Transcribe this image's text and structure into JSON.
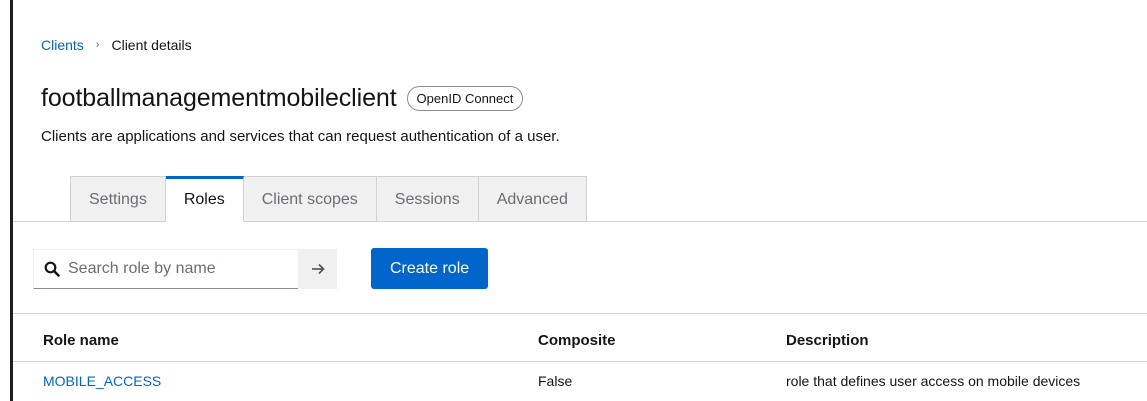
{
  "breadcrumb": {
    "parent": "Clients",
    "separator": "›",
    "current": "Client details"
  },
  "header": {
    "title": "footballmanagementmobileclient",
    "badge": "OpenID Connect",
    "subtitle": "Clients are applications and services that can request authentication of a user."
  },
  "tabs": [
    {
      "label": "Settings",
      "active": false
    },
    {
      "label": "Roles",
      "active": true
    },
    {
      "label": "Client scopes",
      "active": false
    },
    {
      "label": "Sessions",
      "active": false
    },
    {
      "label": "Advanced",
      "active": false
    }
  ],
  "toolbar": {
    "search_placeholder": "Search role by name",
    "search_value": "",
    "create_label": "Create role"
  },
  "table": {
    "columns": [
      "Role name",
      "Composite",
      "Description"
    ],
    "rows": [
      {
        "name": "MOBILE_ACCESS",
        "composite": "False",
        "description": "role that defines user access on mobile devices"
      }
    ]
  },
  "colors": {
    "accent": "#0066cc",
    "text": "#151515",
    "muted": "#6a6e73",
    "border": "#d2d2d2",
    "tab_bg": "#f0f0f0"
  },
  "icons": {
    "search": "search-icon",
    "submit": "arrow-right-icon",
    "breadcrumb_separator": "chevron-right-icon"
  }
}
